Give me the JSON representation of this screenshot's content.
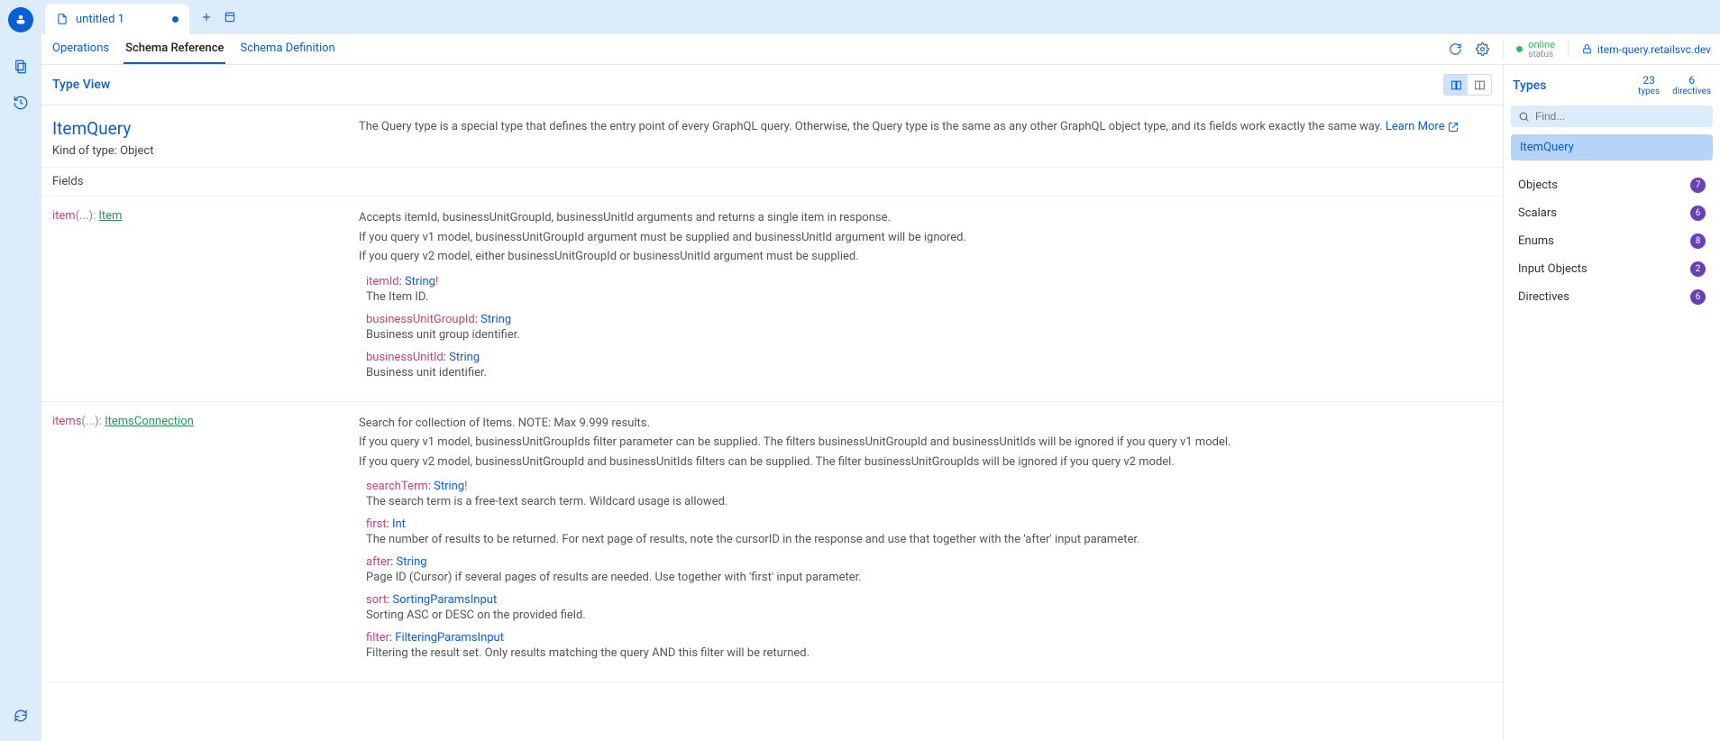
{
  "tab": {
    "title": "untitled 1"
  },
  "subtabs": {
    "operations": "Operations",
    "schema_ref": "Schema Reference",
    "schema_def": "Schema Definition"
  },
  "status": {
    "label": "online",
    "sub": "status"
  },
  "endpoint": "item-query.retailsvc.dev",
  "typeview": {
    "label": "Type View"
  },
  "type": {
    "name": "ItemQuery",
    "kind": "Kind of type: Object",
    "desc": "The Query type is a special type that defines the entry point of every GraphQL query. Otherwise, the Query type is the same as any other GraphQL object type, and its fields work exactly the same way. ",
    "learn_more": "Learn More"
  },
  "fields_label": "Fields",
  "fields": [
    {
      "name": "item",
      "paren": "(...): ",
      "return_type": "Item",
      "desc": [
        "Accepts itemId, businessUnitGroupId, businessUnitId arguments and returns a single item in response.",
        "If you query v1 model, businessUnitGroupId argument must be supplied and businessUnitId argument will be ignored.",
        "If you query v2 model, either businessUnitGroupId or businessUnitId argument must be supplied."
      ],
      "args": [
        {
          "name": "itemId",
          "type": "String",
          "required": true,
          "desc": "The Item ID."
        },
        {
          "name": "businessUnitGroupId",
          "type": "String",
          "required": false,
          "desc": "Business unit group identifier."
        },
        {
          "name": "businessUnitId",
          "type": "String",
          "required": false,
          "desc": "Business unit identifier."
        }
      ]
    },
    {
      "name": "items",
      "paren": "(...): ",
      "return_type": "ItemsConnection",
      "desc": [
        "Search for collection of Items. NOTE: Max 9.999 results.",
        "If you query v1 model, businessUnitGroupIds filter parameter can be supplied. The filters businessUnitGroupId and businessUnitIds will be ignored if you query v1 model.",
        "If you query v2 model, businessUnitGroupId and businessUnitIds filters can be supplied. The filter businessUnitGroupIds will be ignored if you query v2 model."
      ],
      "args": [
        {
          "name": "searchTerm",
          "type": "String",
          "required": true,
          "desc": "The search term is a free-text search term. Wildcard usage is allowed."
        },
        {
          "name": "first",
          "type": "Int",
          "required": false,
          "desc": "The number of results to be returned. For next page of results, note the cursorID in the response and use that together with the 'after' input parameter."
        },
        {
          "name": "after",
          "type": "String",
          "required": false,
          "desc": "Page ID (Cursor) if several pages of results are needed. Use together with 'first' input parameter."
        },
        {
          "name": "sort",
          "type": "SortingParamsInput",
          "required": false,
          "desc": "Sorting ASC or DESC on the provided field."
        },
        {
          "name": "filter",
          "type": "FilteringParamsInput",
          "required": false,
          "desc": "Filtering the result set. Only results matching the query AND this filter will be returned."
        }
      ]
    }
  ],
  "types_panel": {
    "label": "Types",
    "counts": {
      "types_n": "23",
      "types_l": "types",
      "dirs_n": "6",
      "dirs_l": "directives"
    },
    "search_placeholder": "Find...",
    "selected": "ItemQuery",
    "categories": [
      {
        "name": "Objects",
        "count": "7"
      },
      {
        "name": "Scalars",
        "count": "6"
      },
      {
        "name": "Enums",
        "count": "8"
      },
      {
        "name": "Input Objects",
        "count": "2"
      },
      {
        "name": "Directives",
        "count": "6"
      }
    ]
  }
}
